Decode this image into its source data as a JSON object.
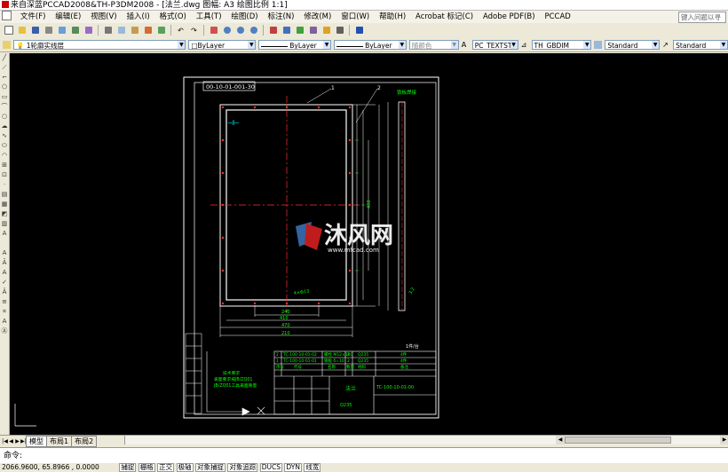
{
  "titlebar": {
    "title": "来自深蓝PCCAD2008&TH-P3DM2008 - [法兰.dwg 图幅: A3 绘图比例 1:1]"
  },
  "menu": {
    "items": [
      "文件(F)",
      "编辑(E)",
      "视图(V)",
      "插入(I)",
      "格式(O)",
      "工具(T)",
      "绘图(D)",
      "标注(N)",
      "修改(M)",
      "窗口(W)",
      "帮助(H)",
      "Acrobat 标记(C)",
      "Adobe PDF(B)",
      "PCCAD"
    ],
    "help_placeholder": "键入问题以寻"
  },
  "properties_bar": {
    "layer": "1轮廓实线层",
    "color": "□ByLayer",
    "linetype": "ByLayer",
    "lineweight": "ByLayer",
    "plotstyle": "随颜色",
    "text_style": "PC_TEXTST1",
    "dim_style": "TH_GBDIM",
    "table_style": "Standard",
    "multileader_style": "Standard"
  },
  "drawing": {
    "part_no_box": "00-10-01-001-30",
    "balloon_1": "1",
    "balloon_2": "2",
    "weld_note": "铁板焊接",
    "notes_block": [
      "技术要求",
      "表面要求按JB/ZQ01",
      "JB/ZQ01工具表面质量"
    ],
    "dimensions": {
      "d1": "240",
      "d2": "410",
      "d3": "470",
      "d4": "400",
      "d5": "4×Φ13",
      "d6": "3.2",
      "d7": "210",
      "d8": "1:1"
    },
    "title_block": {
      "rows": [
        {
          "no": "2",
          "code": "TC-100-10-01-02",
          "name": "螺栓 M12×100",
          "qty": "2",
          "mat": "Q235",
          "note": "4件"
        },
        {
          "no": "1",
          "code": "TC-100-10-01-01",
          "name": "钢板 δ=10",
          "qty": "2",
          "mat": "Q235",
          "note": "4件"
        }
      ],
      "header": [
        "序号",
        "代号",
        "名称",
        "数量",
        "材料",
        "备注"
      ],
      "part_name": "法兰",
      "drawing_no": "TC-100-10-01-00",
      "material": "Q235",
      "scale_label": "1件/台"
    },
    "watermark_text": "沐风网",
    "watermark_url": "www.mfcad.com"
  },
  "tabs": {
    "model": "模型",
    "layout1": "布局1",
    "layout2": "布局2"
  },
  "command": {
    "prompt": "命令:"
  },
  "status": {
    "coords": "2066.9600, 65.8966 , 0.0000",
    "toggles": [
      "捕捉",
      "栅格",
      "正交",
      "极轴",
      "对象捕捉",
      "对象追踪",
      "DUCS",
      "DYN",
      "线宽"
    ]
  },
  "colors": {
    "canvas_bg": "#000000",
    "frame": "#FFFFFF",
    "part": "#FFFFFF",
    "dims": "#00FF00",
    "center": "#FF0000",
    "cyan": "#00FFFF",
    "watermark_red": "#D02020",
    "watermark_blue": "#3A6DB0"
  }
}
